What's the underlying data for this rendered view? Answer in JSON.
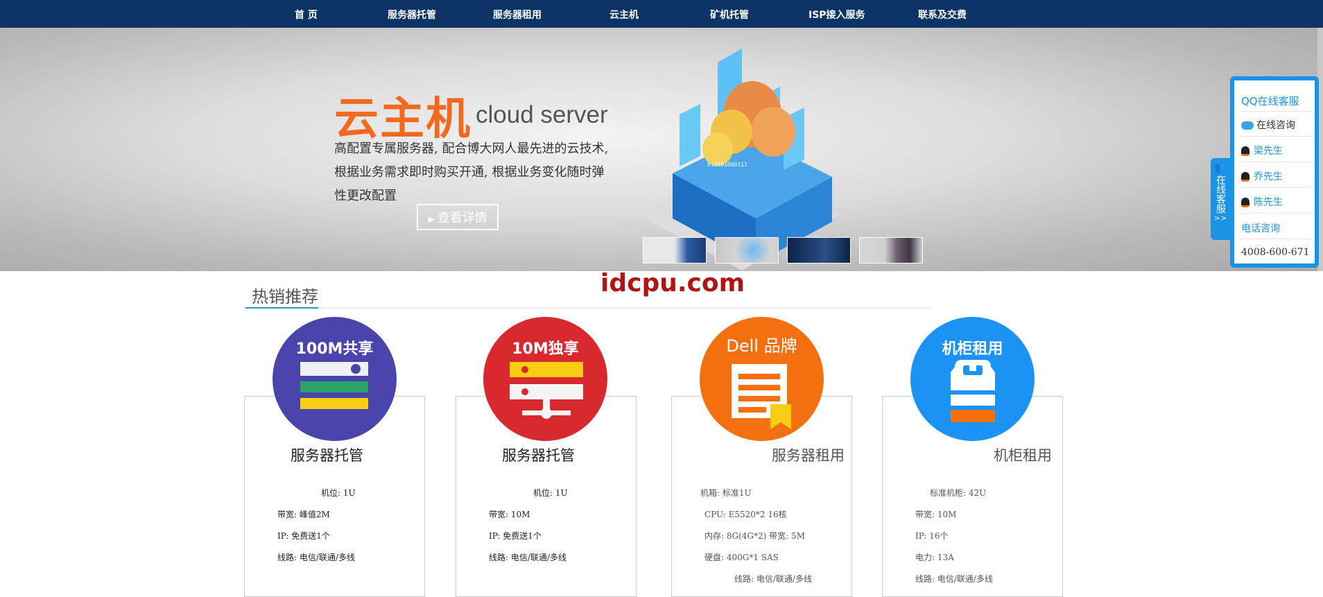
{
  "nav": {
    "items": [
      {
        "label": "首 页"
      },
      {
        "label": "服务器托管"
      },
      {
        "label": "服务器租用"
      },
      {
        "label": "云主机"
      },
      {
        "label": "矿机托管"
      },
      {
        "label": "ISP接入服务"
      },
      {
        "label": "联系及交费"
      }
    ]
  },
  "banner": {
    "title": "云主机",
    "subtitle": "cloud server",
    "desc_lines": [
      "高配置专属服务器, 配合博大网人最先进的云技术,",
      "根据业务需求即时购买开通, 根据业务变化随时弹",
      "性更改配置"
    ],
    "button_label": "查看详情",
    "thumbnails": [
      {
        "name": "thumb-1"
      },
      {
        "name": "thumb-2"
      },
      {
        "name": "thumb-3"
      },
      {
        "name": "thumb-4"
      }
    ]
  },
  "watermark": "idcpu.com",
  "section": {
    "title": "热销推荐"
  },
  "products": [
    {
      "badge": "100M共享",
      "color": "#4a45ad",
      "title": "服务器托管",
      "specs": [
        "机位: 1U",
        "带宽: 峰值2M",
        "IP: 免费送1个",
        "线路: 电信/联通/多线"
      ]
    },
    {
      "badge": "10M独享",
      "color": "#d8292f",
      "title": "服务器托管",
      "specs": [
        "机位: 1U",
        "带宽: 10M",
        "IP: 免费送1个",
        "线路: 电信/联通/多线"
      ]
    },
    {
      "badge": "Dell 品牌",
      "color": "#f36f10",
      "title": "服务器租用",
      "specs": [
        "机箱: 标准1U",
        "CPU: E5520*2   16核",
        "内存: 8G(4G*2) 带宽: 5M",
        "硬盘: 400G*1 SAS",
        "线路: 电信/联通/多线"
      ]
    },
    {
      "badge": "机柜租用",
      "color": "#1b93f5",
      "title": "机柜租用",
      "specs": [
        "标准机柜: 42U",
        "带宽: 10M",
        "IP: 16个",
        "电力: 13A",
        "线路: 电信/联通/多线"
      ]
    }
  ],
  "qq_panel": {
    "header": "QQ在线客服",
    "online": "在线咨询",
    "contacts": [
      "梁先生",
      "乔先生",
      "陈先生"
    ],
    "phone_label": "电话咨询",
    "phone": "4008-600-671",
    "tab_label": "在线客服"
  },
  "colors": {
    "nav_bg": "#0c3466",
    "accent": "#1a93e5",
    "banner_title": "#ef6a1f"
  }
}
